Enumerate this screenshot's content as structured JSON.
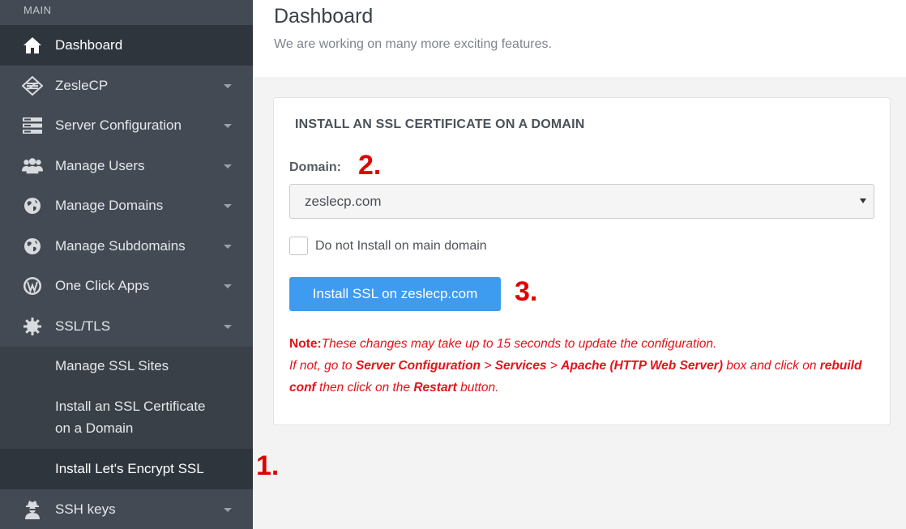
{
  "sidebar": {
    "section_label": "MAIN",
    "items": [
      {
        "label": "Dashboard",
        "icon": "home-icon"
      },
      {
        "label": "ZesleCP",
        "icon": "zeslecp-logo-icon"
      },
      {
        "label": "Server Configuration",
        "icon": "server-icon"
      },
      {
        "label": "Manage Users",
        "icon": "users-icon"
      },
      {
        "label": "Manage Domains",
        "icon": "globe-icon"
      },
      {
        "label": "Manage Subdomains",
        "icon": "globe-icon"
      },
      {
        "label": "One Click Apps",
        "icon": "wordpress-icon"
      },
      {
        "label": "SSL/TLS",
        "icon": "gear-icon"
      },
      {
        "label": "SSH keys",
        "icon": "user-secret-icon"
      }
    ],
    "ssl_subitems": [
      {
        "label": "Manage SSL Sites"
      },
      {
        "label_line1": "Install an SSL Certificate",
        "label_line2": "on a Domain"
      },
      {
        "label": "Install Let's Encrypt SSL"
      }
    ]
  },
  "header": {
    "title": "Dashboard",
    "subtitle": "We are working on many more exciting features."
  },
  "card": {
    "title": "INSTALL AN SSL CERTIFICATE ON A DOMAIN",
    "domain_label": "Domain:",
    "domain_value": "zeslecp.com",
    "checkbox_label": "Do not Install on main domain",
    "button_label": "Install SSL on zeslecp.com",
    "note": {
      "prefix": "Note:",
      "line1": "These changes may take up to 15 seconds to update the configuration.",
      "l2_a": "If not, go to ",
      "l2_b": "Server Configuration",
      "l2_c": " > ",
      "l2_d": "Services",
      "l2_e": " > ",
      "l2_f": "Apache (HTTP Web Server)",
      "l2_g": " box and click on ",
      "l2_h": "rebuild conf",
      "l2_i": " then click on the ",
      "l2_j": "Restart",
      "l2_k": " button."
    }
  },
  "annotations": {
    "step1": "1.",
    "step2": "2.",
    "step3": "3."
  },
  "colors": {
    "sidebar_bg": "#434a54",
    "sidebar_active": "#2f353d",
    "button_blue": "#3d9bf0",
    "note_red": "#e3131b",
    "annotation_red": "#e00000"
  }
}
